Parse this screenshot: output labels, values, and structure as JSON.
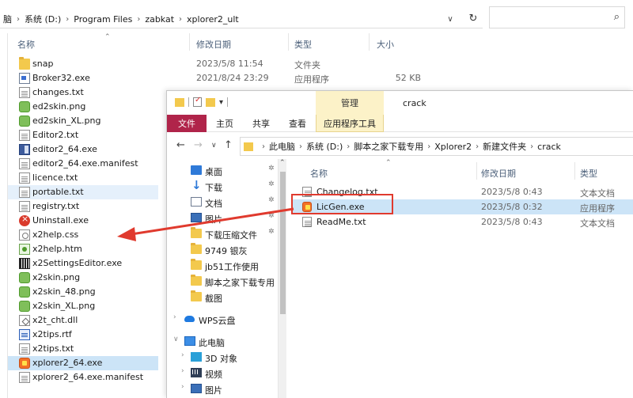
{
  "bg_window": {
    "breadcrumb": [
      "脑",
      "系统 (D:)",
      "Program Files",
      "zabkat",
      "xplorer2_ult"
    ],
    "columns": {
      "name": "名称",
      "date": "修改日期",
      "type": "类型",
      "size": "大小"
    },
    "files": [
      {
        "name": "snap",
        "date": "2023/5/8 11:54",
        "type": "文件夹",
        "size": "",
        "icon": "folder-icon"
      },
      {
        "name": "Broker32.exe",
        "date": "2021/8/24 23:29",
        "type": "应用程序",
        "size": "52 KB",
        "icon": "exe-icon"
      },
      {
        "name": "changes.txt",
        "date": "",
        "type": "",
        "size": "",
        "icon": "text-file-icon"
      },
      {
        "name": "ed2skin.png",
        "date": "",
        "type": "",
        "size": "",
        "icon": "image-file-icon"
      },
      {
        "name": "ed2skin_XL.png",
        "date": "",
        "type": "",
        "size": "",
        "icon": "image-file-icon"
      },
      {
        "name": "Editor2.txt",
        "date": "",
        "type": "",
        "size": "",
        "icon": "text-file-icon"
      },
      {
        "name": "editor2_64.exe",
        "date": "",
        "type": "",
        "size": "",
        "icon": "editor-exe-icon"
      },
      {
        "name": "editor2_64.exe.manifest",
        "date": "",
        "type": "",
        "size": "",
        "icon": "text-file-icon"
      },
      {
        "name": "licence.txt",
        "date": "",
        "type": "",
        "size": "",
        "icon": "text-file-icon"
      },
      {
        "name": "portable.txt",
        "date": "",
        "type": "",
        "size": "",
        "icon": "text-file-icon"
      },
      {
        "name": "registry.txt",
        "date": "",
        "type": "",
        "size": "",
        "icon": "text-file-icon"
      },
      {
        "name": "Uninstall.exe",
        "date": "",
        "type": "",
        "size": "",
        "icon": "uninstall-icon"
      },
      {
        "name": "x2help.css",
        "date": "",
        "type": "",
        "size": "",
        "icon": "css-file-icon"
      },
      {
        "name": "x2help.htm",
        "date": "",
        "type": "",
        "size": "",
        "icon": "html-file-icon"
      },
      {
        "name": "x2SettingsEditor.exe",
        "date": "",
        "type": "",
        "size": "",
        "icon": "settings-editor-icon"
      },
      {
        "name": "x2skin.png",
        "date": "",
        "type": "",
        "size": "",
        "icon": "image-file-icon"
      },
      {
        "name": "x2skin_48.png",
        "date": "",
        "type": "",
        "size": "",
        "icon": "image-file-icon"
      },
      {
        "name": "x2skin_XL.png",
        "date": "",
        "type": "",
        "size": "",
        "icon": "image-file-icon"
      },
      {
        "name": "x2t_cht.dll",
        "date": "",
        "type": "",
        "size": "",
        "icon": "dll-file-icon"
      },
      {
        "name": "x2tips.rtf",
        "date": "",
        "type": "",
        "size": "",
        "icon": "rtf-file-icon"
      },
      {
        "name": "x2tips.txt",
        "date": "",
        "type": "",
        "size": "",
        "icon": "text-file-icon"
      },
      {
        "name": "xplorer2_64.exe",
        "date": "",
        "type": "",
        "size": "",
        "icon": "xplorer2-icon"
      },
      {
        "name": "xplorer2_64.exe.manifest",
        "date": "",
        "type": "",
        "size": "",
        "icon": "text-file-icon"
      }
    ],
    "selected_file": "xplorer2_64.exe",
    "hover_file": "portable.txt"
  },
  "fg_window": {
    "title_tab_manage": "管理",
    "title_folder": "crack",
    "ribbon_tabs": [
      "文件",
      "主页",
      "共享",
      "查看",
      "应用程序工具"
    ],
    "breadcrumb": [
      "此电脑",
      "系统 (D:)",
      "脚本之家下载专用",
      "Xplorer2",
      "新建文件夹",
      "crack"
    ],
    "nav_tree": [
      {
        "label": "桌面",
        "pinned": true,
        "icon": "desktop-icon"
      },
      {
        "label": "下载",
        "pinned": true,
        "icon": "download-icon"
      },
      {
        "label": "文档",
        "pinned": true,
        "icon": "documents-icon"
      },
      {
        "label": "图片",
        "pinned": true,
        "icon": "pictures-icon"
      },
      {
        "label": "下载压缩文件",
        "pinned": true,
        "icon": "folder-icon"
      },
      {
        "label": "9749 银灰",
        "pinned": false,
        "icon": "folder-icon"
      },
      {
        "label": "jb51工作使用",
        "pinned": false,
        "icon": "folder-icon"
      },
      {
        "label": "脚本之家下载专用",
        "pinned": false,
        "icon": "folder-icon"
      },
      {
        "label": "截图",
        "pinned": false,
        "icon": "folder-icon"
      },
      {
        "label": "WPS云盘",
        "pinned": false,
        "icon": "wps-cloud-icon"
      },
      {
        "label": "此电脑",
        "pinned": false,
        "icon": "this-pc-icon"
      },
      {
        "label": "3D 对象",
        "pinned": false,
        "icon": "3d-objects-icon"
      },
      {
        "label": "视频",
        "pinned": false,
        "icon": "videos-icon"
      },
      {
        "label": "图片",
        "pinned": false,
        "icon": "pictures-icon"
      }
    ],
    "columns": {
      "name": "名称",
      "date": "修改日期",
      "type": "类型"
    },
    "files": [
      {
        "name": "Changelog.txt",
        "date": "2023/5/8 0:43",
        "type": "文本文档",
        "icon": "text-file-icon"
      },
      {
        "name": "LicGen.exe",
        "date": "2023/5/8 0:32",
        "type": "应用程序",
        "icon": "licgen-icon"
      },
      {
        "name": "ReadMe.txt",
        "date": "2023/5/8 0:43",
        "type": "文本文档",
        "icon": "text-file-icon"
      }
    ],
    "selected_file": "LicGen.exe"
  },
  "colors": {
    "annotation_red": "#e03a2e",
    "selection": "#cce4f7",
    "file_tab": "#b0244a",
    "manage_tab": "#fcf2c8"
  }
}
